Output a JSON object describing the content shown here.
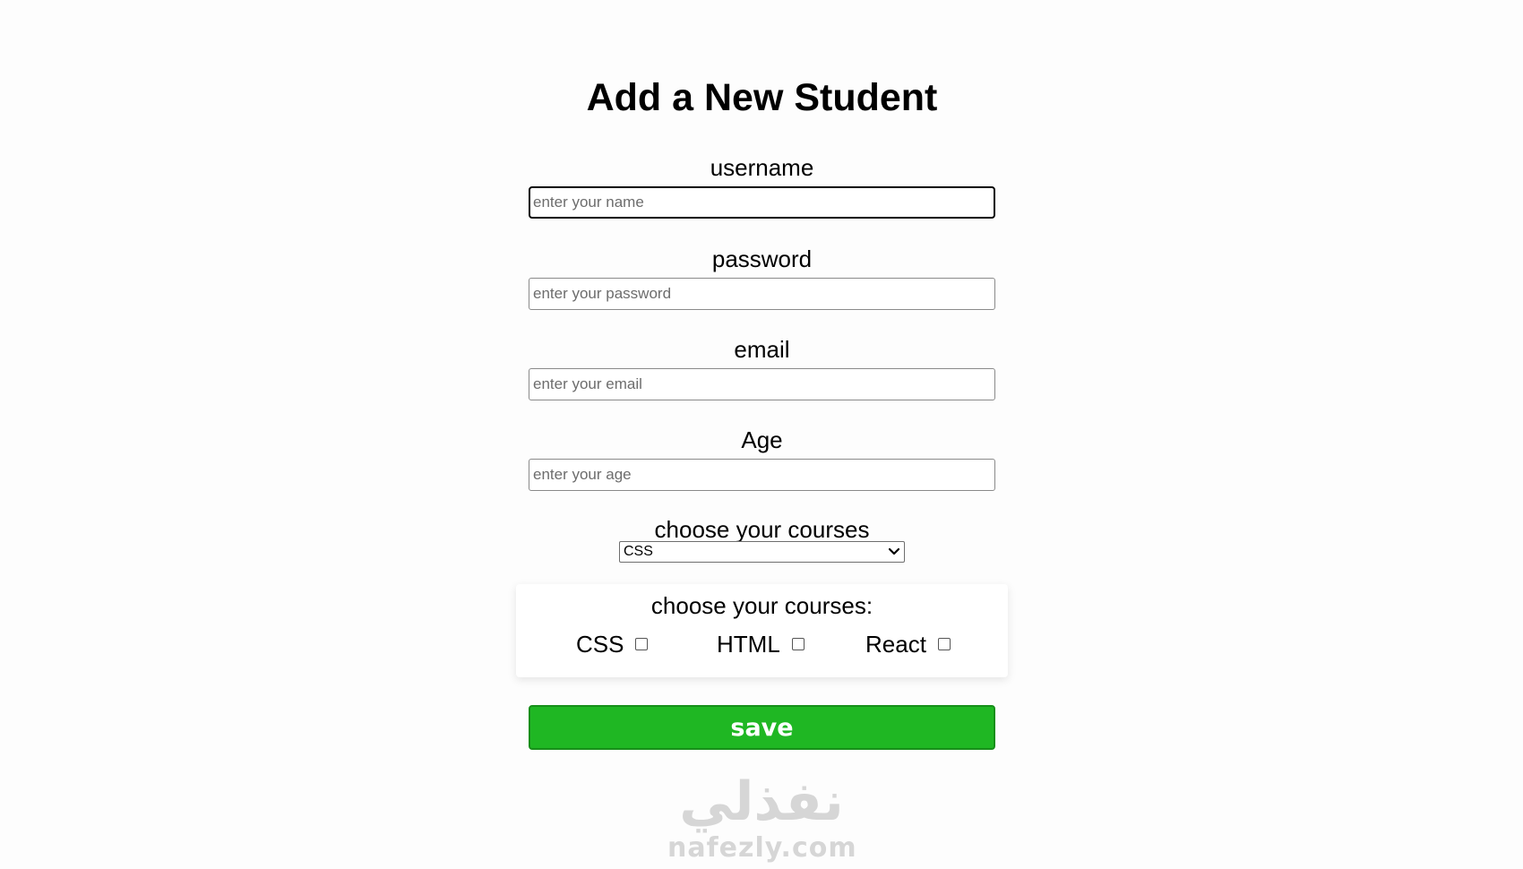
{
  "page": {
    "title": "Add a New Student"
  },
  "fields": {
    "username": {
      "label": "username",
      "placeholder": "enter your name",
      "value": ""
    },
    "password": {
      "label": "password",
      "placeholder": "enter your password",
      "value": ""
    },
    "email": {
      "label": "email",
      "placeholder": "enter your email",
      "value": ""
    },
    "age": {
      "label": "Age",
      "placeholder": "enter your age",
      "value": ""
    }
  },
  "course_select": {
    "label": "choose your courses",
    "selected": "CSS"
  },
  "course_checkboxes": {
    "title": "choose your courses:",
    "options": [
      {
        "label": "CSS",
        "checked": false
      },
      {
        "label": "HTML",
        "checked": false
      },
      {
        "label": "React",
        "checked": false
      }
    ]
  },
  "actions": {
    "save_label": "save"
  },
  "colors": {
    "save_button": "#1fb723",
    "background": "#fdfdfd"
  },
  "watermark": {
    "arabic": "نفذلي",
    "latin": "nafezly.com"
  }
}
